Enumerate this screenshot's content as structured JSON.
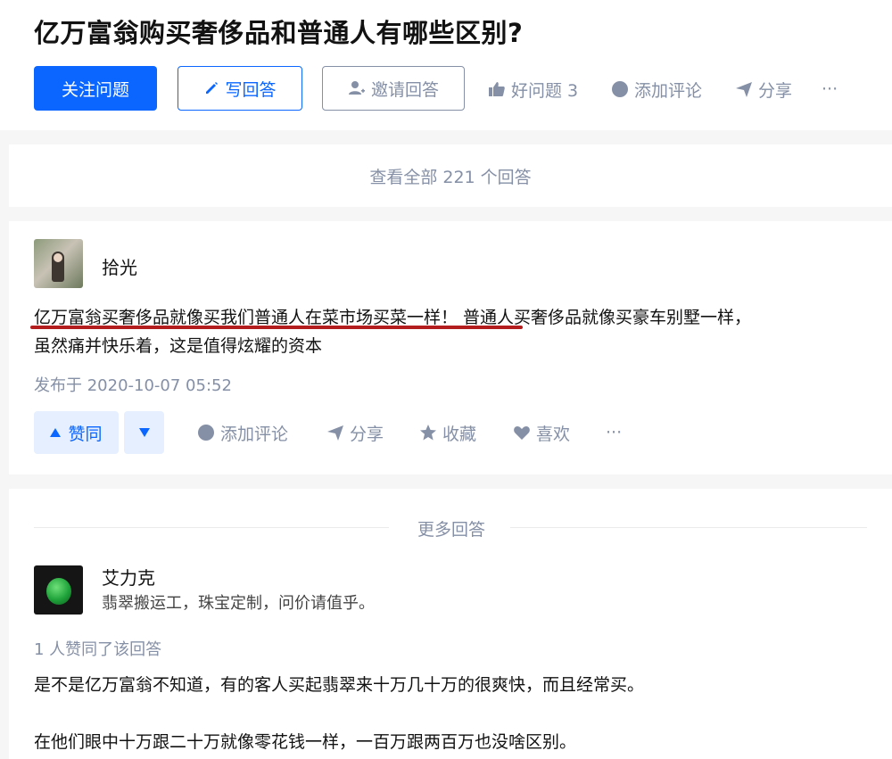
{
  "question": {
    "title": "亿万富翁购买奢侈品和普通人有哪些区别?",
    "follow_label": "关注问题",
    "write_label": "写回答",
    "invite_label": "邀请回答",
    "good_question_label": "好问题 3",
    "comment_label": "添加评论",
    "share_label": "分享",
    "more_label": "···"
  },
  "view_all_label": "查看全部 221 个回答",
  "answer1": {
    "author": "拾光",
    "content_line1": "亿万富翁买奢侈品就像买我们普通人在菜市场买菜一样！ 普通人买奢侈品就像买豪车别墅一样，",
    "content_line2": "虽然痛并快乐着，这是值得炫耀的资本",
    "published": "发布于 2020-10-07 05:52",
    "vote_label": "赞同",
    "comment_label": "添加评论",
    "share_label": "分享",
    "collect_label": "收藏",
    "like_label": "喜欢",
    "more_label": "···"
  },
  "more_answers": {
    "section_title": "更多回答",
    "author": "艾力克",
    "bio": "翡翠搬运工，珠宝定制，问价请值乎。",
    "vote_count": "1 人赞同了该回答",
    "content_line1": "是不是亿万富翁不知道，有的客人买起翡翠来十万几十万的很爽快，而且经常买。",
    "content_line2": "在他们眼中十万跟二十万就像零花钱一样，一百万跟两百万也没啥区别。"
  },
  "colors": {
    "brand_blue": "#0a66ff",
    "meta_gray": "#8590a6",
    "underline_red": "#b31d1d"
  }
}
